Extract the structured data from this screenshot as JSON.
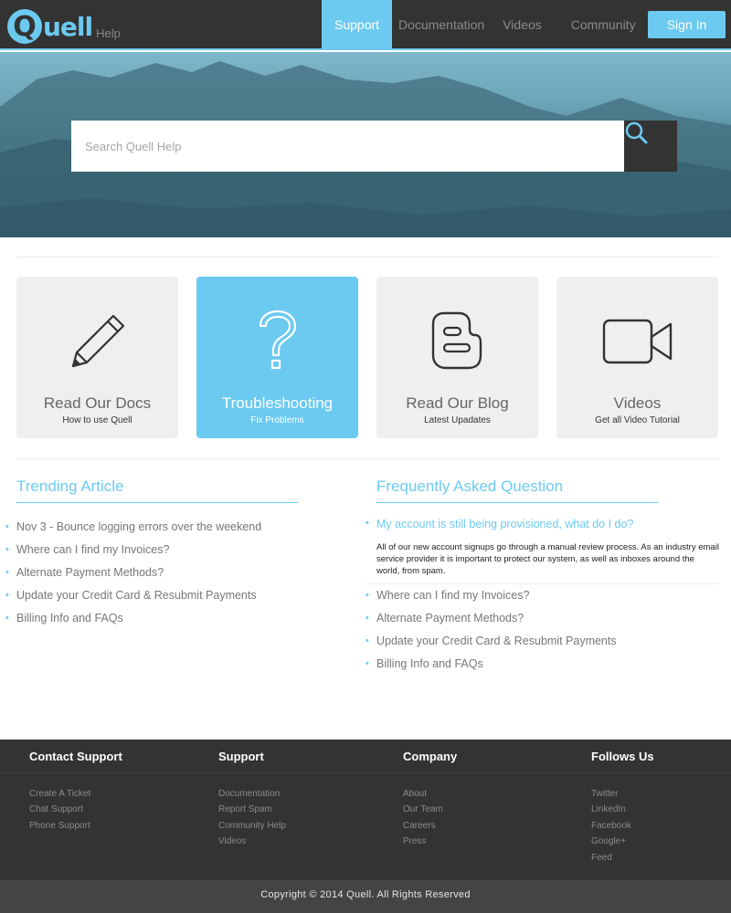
{
  "nav": {
    "logo_text": "Quell",
    "logo_letter": "Q",
    "logo_sub": "Help",
    "links": [
      "Support",
      "Documentation",
      "Videos",
      "Community"
    ],
    "active": "Support",
    "signin_label": "Sign In"
  },
  "search": {
    "placeholder": "Search Quell Help",
    "value": ""
  },
  "cards": [
    {
      "title": "Read Our Docs",
      "subtitle": "How to use Quell",
      "icon": "pencil-icon"
    },
    {
      "title": "Troubleshooting",
      "subtitle": "Fix Problems",
      "icon": "question-mark-icon"
    },
    {
      "title": "Read Our Blog",
      "subtitle": "Latest Upadates",
      "icon": "blogger-icon"
    },
    {
      "title": "Videos",
      "subtitle": "Get all Video Tutorial",
      "icon": "video-camera-icon"
    }
  ],
  "trending": {
    "title": "Trending Article",
    "items": [
      "Nov 3 - Bounce logging errors over the weekend",
      "Where can I find my Invoices?",
      "Alternate Payment Methods?",
      "Update your Credit Card & Resubmit Payments",
      "Billing Info and FAQs"
    ]
  },
  "faq": {
    "title": "Frequently Asked Question",
    "active_question": "My account is still being provisioned, what do I do?",
    "active_answer": "All of our new account signups go through a manual review process. As an industry email service provider it is important to protect our system, as well as inboxes around the world, from spam.",
    "items": [
      "Where can I find my Invoices?",
      "Alternate Payment Methods?",
      "Update your Credit Card & Resubmit Payments",
      "Billing Info and FAQs"
    ]
  },
  "footer": {
    "columns": [
      {
        "heading": "Contact Support",
        "links": [
          "Create A Ticket",
          "Chat Support",
          "Phone Support"
        ]
      },
      {
        "heading": "Support",
        "links": [
          "Documentation",
          "Report Spam",
          "Community Help",
          "Videos"
        ]
      },
      {
        "heading": "Company",
        "links": [
          "About",
          "Our Team",
          "Careers",
          "Press"
        ]
      },
      {
        "heading": "Follows Us",
        "links": [
          "Twitter",
          "LinkedIn",
          "Facebook",
          "Google+",
          "Feed"
        ]
      }
    ],
    "copyright": "Copyright © 2014 Quell. All Rights Reserved"
  },
  "colors": {
    "accent": "#6ccaf0",
    "nav_bg": "#333333",
    "card_bg": "#efefef",
    "footer_bg": "#333333",
    "copyright_bg": "#444444"
  }
}
